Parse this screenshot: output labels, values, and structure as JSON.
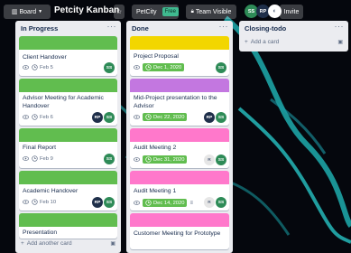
{
  "topbar": {
    "board_menu_label": "Board",
    "board_title": "Petcity Kanban",
    "team_name": "PetCity",
    "team_badge": "Free",
    "visibility_label": "Team Visible",
    "members": [
      "SS",
      "RP"
    ],
    "invite_label": "Invite"
  },
  "lists": [
    {
      "title": "In Progress",
      "add_label": "Add another card",
      "cards": [
        {
          "title": "Client Handover",
          "due": "Feb 5",
          "members": [
            "SS"
          ]
        },
        {
          "title": "Advisor Meeting for Academic Handover",
          "due": "Feb 6",
          "members": [
            "RP",
            "SS"
          ]
        },
        {
          "title": "Final Report",
          "due": "Feb 9",
          "members": [
            "SS"
          ]
        },
        {
          "title": "Academic Handover",
          "due": "Feb 10",
          "members": [
            "RP",
            "SS"
          ]
        },
        {
          "title": "Presentation"
        }
      ]
    },
    {
      "title": "Done",
      "cards": [
        {
          "title": "Project Proposal",
          "due": "Dec 1, 2020",
          "members": [
            "SS"
          ]
        },
        {
          "title": "Mid-Project presentation to the Advisor",
          "due": "Dec 22, 2020",
          "members": [
            "RP",
            "SS"
          ]
        },
        {
          "title": "Audit Meeting 2",
          "due": "Dec 31, 2020",
          "members": [
            "R",
            "SS"
          ]
        },
        {
          "title": "Audit Meeting 1",
          "due": "Dec 14, 2020",
          "members": [
            "R",
            "SS"
          ]
        },
        {
          "title": "Customer Meeting for Prototype"
        }
      ]
    },
    {
      "title": "Closing-todo",
      "add_label": "Add a card"
    }
  ],
  "colors": {
    "green_label": "#61bd4f",
    "yellow_label": "#f2d600",
    "purple_label": "#c377e0",
    "pink_label": "#ff78cb",
    "member_ss": "#2e8b57",
    "member_rp": "#1f2f4a",
    "member_r": "#e6e6e6"
  },
  "icons": [
    "board-icon",
    "star-icon",
    "lock-icon",
    "eye-icon",
    "clock-icon",
    "description-icon",
    "plus-icon",
    "card-template-icon"
  ]
}
